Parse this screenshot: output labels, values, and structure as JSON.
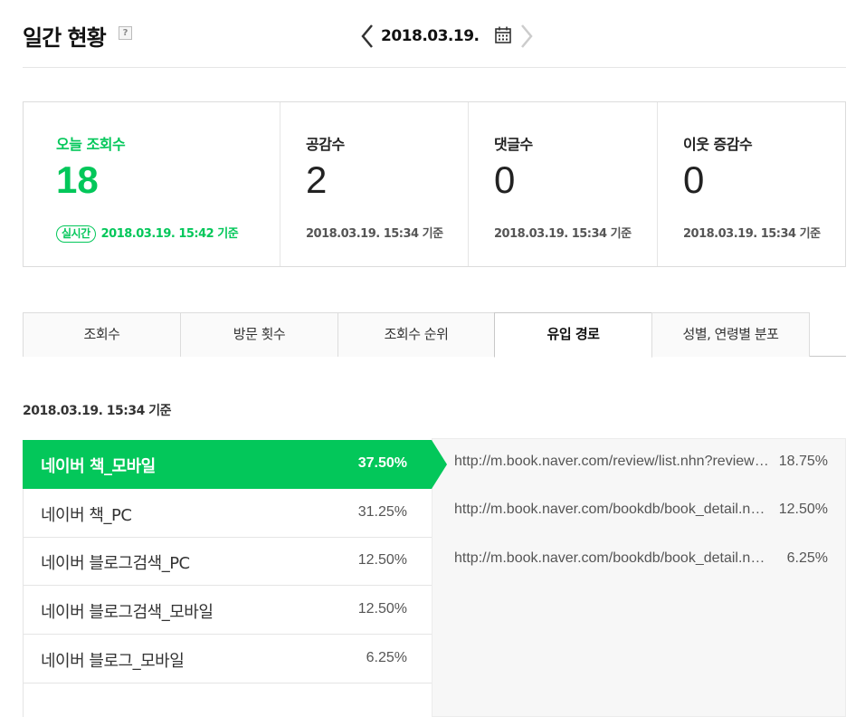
{
  "header": {
    "title": "일간 현황",
    "help_icon": "?",
    "date": "2018.03.19."
  },
  "stats": [
    {
      "label": "오늘 조회수",
      "value": "18",
      "badge": "실시간",
      "time": "2018.03.19. 15:42 기준"
    },
    {
      "label": "공감수",
      "value": "2",
      "time": "2018.03.19. 15:34 기준"
    },
    {
      "label": "댓글수",
      "value": "0",
      "time": "2018.03.19. 15:34 기준"
    },
    {
      "label": "이웃 증감수",
      "value": "0",
      "time": "2018.03.19. 15:34 기준"
    }
  ],
  "tabs": [
    {
      "label": "조회수"
    },
    {
      "label": "방문 횟수"
    },
    {
      "label": "조회수 순위"
    },
    {
      "label": "유입 경로"
    },
    {
      "label": "성별, 연령별 분포"
    }
  ],
  "basis_time": "2018.03.19. 15:34 기준",
  "sources": [
    {
      "name": "네이버 책_모바일",
      "pct": "37.50%"
    },
    {
      "name": "네이버 책_PC",
      "pct": "31.25%"
    },
    {
      "name": "네이버 블로그검색_PC",
      "pct": "12.50%"
    },
    {
      "name": "네이버 블로그검색_모바일",
      "pct": "12.50%"
    },
    {
      "name": "네이버 블로그_모바일",
      "pct": "6.25%"
    }
  ],
  "urls": [
    {
      "url": "http://m.book.naver.com/review/list.nhn?reviewType=...",
      "pct": "18.75%"
    },
    {
      "url": "http://m.book.naver.com/bookdb/book_detail.nhn?bid=...",
      "pct": "12.50%"
    },
    {
      "url": "http://m.book.naver.com/bookdb/book_detail.nhn?bid=...",
      "pct": "6.25%"
    }
  ],
  "colors": {
    "accent": "#03c75a"
  }
}
